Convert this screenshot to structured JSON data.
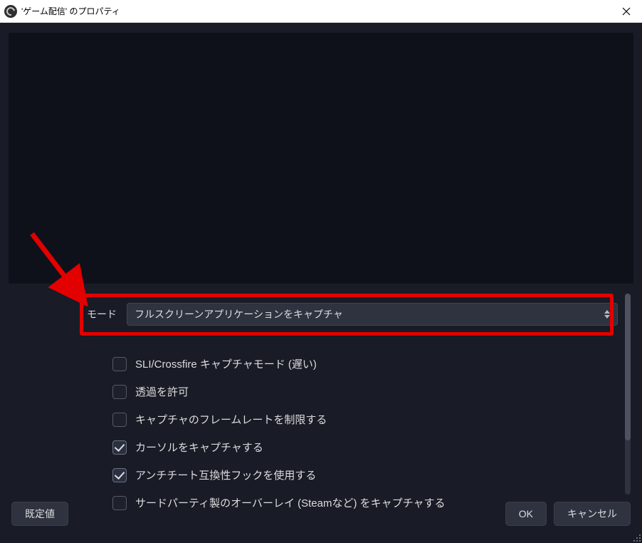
{
  "titlebar": {
    "title": "'ゲーム配信' のプロパティ"
  },
  "mode": {
    "label": "モード",
    "value": "フルスクリーンアプリケーションをキャプチャ"
  },
  "checkboxes": [
    {
      "label": "SLI/Crossfire キャプチャモード (遅い)",
      "checked": false
    },
    {
      "label": "透過を許可",
      "checked": false
    },
    {
      "label": "キャプチャのフレームレートを制限する",
      "checked": false
    },
    {
      "label": "カーソルをキャプチャする",
      "checked": true
    },
    {
      "label": "アンチチート互換性フックを使用する",
      "checked": true
    },
    {
      "label": "サードパーティ製のオーバーレイ (Steamなど) をキャプチャする",
      "checked": false
    }
  ],
  "buttons": {
    "defaults": "既定値",
    "ok": "OK",
    "cancel": "キャンセル"
  },
  "annotation": {
    "type": "arrow",
    "color": "#e20000",
    "target": "mode-select"
  }
}
